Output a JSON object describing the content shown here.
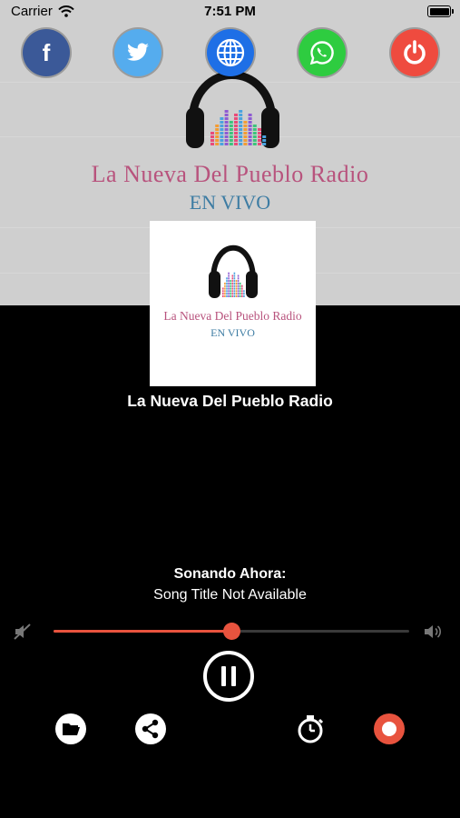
{
  "status_bar": {
    "carrier": "Carrier",
    "time": "7:51 PM"
  },
  "social_buttons": [
    {
      "name": "facebook",
      "icon": "facebook-icon",
      "glyph": "f",
      "color": "#3b5998"
    },
    {
      "name": "twitter",
      "icon": "twitter-icon",
      "color": "#55acee"
    },
    {
      "name": "website",
      "icon": "globe-icon",
      "color": "#1e6fe6"
    },
    {
      "name": "whatsapp",
      "icon": "whatsapp-icon",
      "color": "#2ecc40"
    },
    {
      "name": "power",
      "icon": "power-icon",
      "color": "#ef4b3f"
    }
  ],
  "background_logo": {
    "title": "La Nueva Del Pueblo Radio",
    "subtitle": "EN VIVO"
  },
  "cover_logo": {
    "title": "La Nueva Del Pueblo Radio",
    "subtitle": "EN VIVO"
  },
  "station": {
    "name": "La Nueva Del Pueblo Radio"
  },
  "now_playing": {
    "label": "Sonando Ahora:",
    "song": "Song Title Not Available"
  },
  "volume": {
    "level": 0.5,
    "min_icon": "volume-mute-icon",
    "max_icon": "volume-up-icon"
  },
  "player": {
    "state": "playing",
    "toggle_icon": "pause-icon"
  },
  "controls": [
    {
      "name": "folder-button",
      "icon": "folder-icon"
    },
    {
      "name": "share-button",
      "icon": "share-icon"
    },
    {
      "name": "timer-button",
      "icon": "timer-icon"
    },
    {
      "name": "record-button",
      "icon": "record-icon",
      "color": "#e8533e"
    }
  ],
  "colors": {
    "accent": "#e8533e",
    "logo_pink": "#b8537d",
    "logo_blue": "#3d7ca3"
  }
}
